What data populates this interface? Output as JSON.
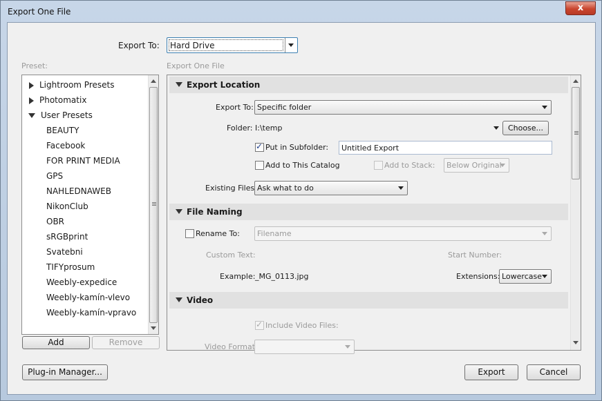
{
  "window": {
    "title": "Export One File",
    "close_glyph": "x"
  },
  "header": {
    "export_to_label": "Export To:",
    "export_to_value": "Hard Drive"
  },
  "preset": {
    "label": "Preset:",
    "groups": [
      {
        "label": "Lightroom Presets",
        "expanded": false
      },
      {
        "label": "Photomatix",
        "expanded": false
      },
      {
        "label": "User Presets",
        "expanded": true
      }
    ],
    "user_presets": [
      "BEAUTY",
      "Facebook",
      "FOR PRINT MEDIA",
      "GPS",
      "NAHLEDNAWEB",
      "NikonClub",
      "OBR",
      "sRGBprint",
      "Svatebni",
      "TIFYprosum",
      "Weebly-expedice",
      "Weebly-kamín-vlevo",
      "Weebly-kamín-vpravo"
    ],
    "add_label": "Add",
    "remove_label": "Remove"
  },
  "right": {
    "label": "Export One File",
    "export_location": {
      "header": "Export Location",
      "export_to_label": "Export To:",
      "export_to_value": "Specific folder",
      "folder_label": "Folder:",
      "folder_value": "I:\\temp",
      "choose_label": "Choose...",
      "subfolder_label": "Put in Subfolder:",
      "subfolder_checked": true,
      "subfolder_value": "Untitled Export",
      "add_catalog_label": "Add to This Catalog",
      "add_catalog_checked": false,
      "add_stack_label": "Add to Stack:",
      "add_stack_checked": false,
      "stack_value": "Below Original",
      "existing_label": "Existing Files:",
      "existing_value": "Ask what to do"
    },
    "file_naming": {
      "header": "File Naming",
      "rename_label": "Rename To:",
      "rename_checked": false,
      "rename_value": "Filename",
      "custom_text_label": "Custom Text:",
      "start_number_label": "Start Number:",
      "example_label": "Example:",
      "example_value": "_MG_0113.jpg",
      "extensions_label": "Extensions:",
      "extensions_value": "Lowercase"
    },
    "video": {
      "header": "Video",
      "include_label": "Include Video Files:",
      "include_checked": true,
      "format_label": "Video Format:"
    }
  },
  "footer": {
    "plugin_label": "Plug-in Manager...",
    "export_label": "Export",
    "cancel_label": "Cancel"
  },
  "colors": {
    "title_bg": "#c7d6e8",
    "close_red": "#c9452e",
    "section_bg": "#e1e1e1"
  }
}
